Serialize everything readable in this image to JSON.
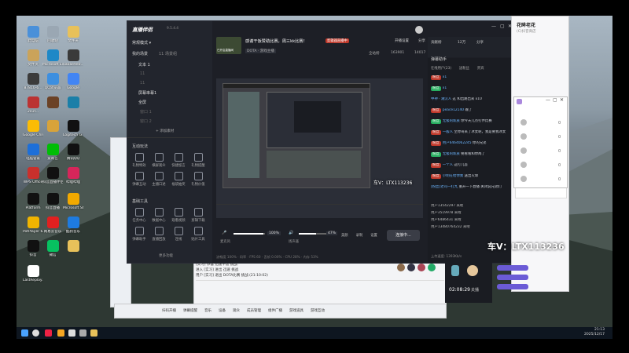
{
  "desktop_icons": [
    {
      "label": "此电脑",
      "color": "#4a90d9"
    },
    {
      "label": "回收站",
      "color": "#9aa7b3"
    },
    {
      "label": "文件夹",
      "color": "#e8c15a"
    },
    {
      "label": "文件夹",
      "color": "#caa35a"
    },
    {
      "label": "Microsoft Edge",
      "color": "#1e88c7"
    },
    {
      "label": "0a0ae9e0...",
      "color": "#3a3a3a"
    },
    {
      "label": "87810-6...",
      "color": "#3b3b3b"
    },
    {
      "label": "QQ浏览器",
      "color": "#3d8fe0"
    },
    {
      "label": "Google",
      "color": "#4285f4"
    },
    {
      "label": "2e1f...",
      "color": "#b33"
    },
    {
      "label": "",
      "color": "#6b4226"
    },
    {
      "label": "",
      "color": "#1b7fa8"
    },
    {
      "label": "Google Chrome",
      "color": "#fbbc05"
    },
    {
      "label": "",
      "color": "#d8a33a"
    },
    {
      "label": "Logitech G HUB",
      "color": "#111"
    },
    {
      "label": "电脑管家",
      "color": "#1d6fd8"
    },
    {
      "label": "爱奇艺",
      "color": "#00be06"
    },
    {
      "label": "腾讯QQ",
      "color": "#111"
    },
    {
      "label": "WPS Office",
      "color": "#c9302c"
    },
    {
      "label": "抖音直播伴侣",
      "color": "#111"
    },
    {
      "label": "哔哩哔哩",
      "color": "#d6265a"
    },
    {
      "label": "Platform",
      "color": "#111"
    },
    {
      "label": "抖音直播",
      "color": "#111"
    },
    {
      "label": "Microsoft Store",
      "color": "#f2a900"
    },
    {
      "label": "PotPlayer 64 bit",
      "color": "#f0b400"
    },
    {
      "label": "网易云音乐",
      "color": "#e02020"
    },
    {
      "label": "酷狗音乐",
      "color": "#1e7be0"
    },
    {
      "label": "抖音",
      "color": "#111"
    },
    {
      "label": "微信",
      "color": "#07c160"
    },
    {
      "label": "",
      "color": "#e8c15a"
    },
    {
      "label": "LastReplay...",
      "color": "#fff"
    }
  ],
  "app": {
    "logo": "直播伴侣",
    "version": "9.5.4.4",
    "sidebar": {
      "mode_label": "常规模式 ▾",
      "scene_header": "我的场景",
      "scene_sub": "11 场景组",
      "layers": [
        "文本 1",
        "11",
        "11",
        "屏幕串幕1",
        "全屏",
        "窗口 1",
        "窗口 2"
      ],
      "add_material": "+ 添加素材",
      "interact_header": "互动玩法",
      "interact_tools": [
        "礼物特效",
        "横屏观众",
        "快捷留言",
        "礼物提醒",
        "弹幕互动",
        "主播口述",
        "福袋抽奖",
        "礼物价值"
      ],
      "basic_header": "基础工具",
      "basic_tools": [
        "任务中心",
        "数据中心",
        "观看视频",
        "剪辑下载",
        "弹幕助手",
        "直播回放",
        "连线",
        "贴片工具"
      ],
      "more_label": "更多功能"
    },
    "header": {
      "title": "感谢干饭赞助比赛，周三kk比赛！",
      "badge": "剪辑器直播中",
      "cover_text": "已开启直播间",
      "category": "DOTA · 游戏主播",
      "share": "分享",
      "start_live": "开播设置",
      "stat1": "全站榜",
      "stat2": "163901",
      "stat3": "14017"
    },
    "preview": {
      "mic_label": "麦克风",
      "speaker_label": "扬声器",
      "volume1": "100%",
      "volume2": "47%",
      "buttons": [
        "美颜",
        "录制",
        "设置"
      ],
      "connect": "连接中..."
    },
    "status_bar": "流畅度 100% · 码率 · FPS 60 · 丢帧 0.00% · CPU 28% · 内存 53%",
    "right": {
      "tabs": [
        "贡献榜",
        "12万",
        "分享"
      ],
      "assistant": "弹幕助手",
      "sub_tabs": [
        "在线用户(23)",
        "送粉丝",
        "贵宾"
      ],
      "chat": [
        {
          "tag": "粉丝",
          "nick": "x1",
          "text": ""
        },
        {
          "tag": "粉丝",
          "nick": "x1",
          "text": ""
        },
        {
          "tag": "",
          "nick": "中神 · 潮汉人",
          "text": "这 和出路出来 x10"
        },
        {
          "tag": "粉丝",
          "nick": "peace12140",
          "text": "输了"
        },
        {
          "tag": "粉丝",
          "nick": "无极的新族",
          "text": "你今天几点打伴比赛"
        },
        {
          "tag": "粉丝",
          "nick": "一般人",
          "text": "至你哥来了冰女呢，我是要我冰女"
        },
        {
          "tag": "粉丝",
          "nick": "用户6464062245",
          "text": "你的兄弟"
        },
        {
          "tag": "粉丝",
          "nick": "无极的新族",
          "text": "要看看和你两了"
        },
        {
          "tag": "粉丝",
          "nick": "一个人",
          "text": "这打几首"
        },
        {
          "tag": "粉丝",
          "nick": "小明在给你我",
          "text": "送出火球"
        },
        {
          "tag": "",
          "nick": "[粉丝]老司一打九",
          "text": "重开一下直播 关闭说兄弟们"
        }
      ],
      "enter": [
        "用户13542297 来啦",
        "用户3519978 来啦",
        "用户6486431 来啦",
        "用户13480764232 来啦"
      ],
      "timer": "02:08:29",
      "timer_label": "关播",
      "speed": "上传速度: 1393Kb/s"
    }
  },
  "back_window": {
    "title": "直播间",
    "lines": [
      "[实习] 恭喜 迅速干饭 挑战.",
      "进入 [实习] 进出 迅速 挑战",
      "用户 [实习] 退出 DOTA比赛 挑战.(21:10:02)"
    ],
    "toolbar": [
      "扫码开播",
      "弹幕提醒",
      "音乐",
      "设备",
      "观众",
      "成员管理",
      "组件广播",
      "游戏道具",
      "游戏互动"
    ]
  },
  "floating": {
    "title": "花眸老花",
    "sub": "(C)抖音商店",
    "tabs": [
      "直播",
      "PK",
      "粉丝",
      "直播间"
    ],
    "items": [
      "0",
      "0",
      "0",
      "0",
      "0"
    ]
  },
  "watermark": "车V：LTX113236",
  "watermark_small": "车V：LTX113236",
  "taskbar": {
    "time": "21:13",
    "date": "2025/12/17"
  }
}
